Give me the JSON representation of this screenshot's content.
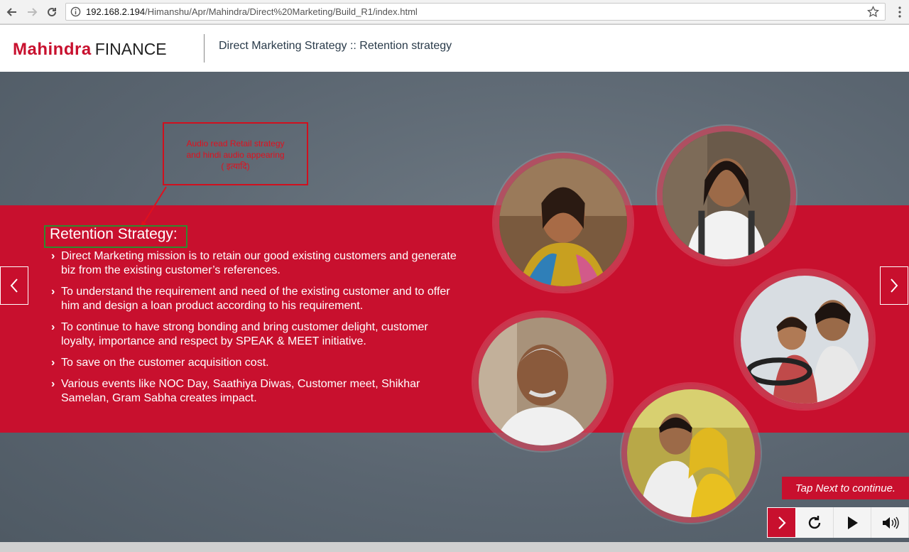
{
  "browser": {
    "url_host": "192.168.2.194",
    "url_path": "/Himanshu/Apr/Mahindra/Direct%20Marketing/Build_R1/index.html"
  },
  "header": {
    "brand": "Mahindra",
    "brand_sub": "FINANCE",
    "title": "Direct Marketing Strategy :: Retention strategy"
  },
  "callout": {
    "lines": [
      "Audio read Retail strategy",
      "and hindi audio appearing",
      "( इत्यादि)"
    ]
  },
  "content": {
    "heading": "Retention Strategy:",
    "bullets": [
      "Direct Marketing mission is to retain our good existing customers and generate biz from the existing customer’s references.",
      "To understand the requirement and need of the existing customer and to offer him and design a loan product according to his requirement.",
      "To continue to have strong bonding and bring customer delight, customer loyalty, importance and respect by SPEAK & MEET initiative.",
      "To save on the customer acquisition cost.",
      "Various events like NOC Day, Saathiya Diwas, Customer meet, Shikhar Samelan, Gram Sabha creates impact."
    ],
    "chevron": "›"
  },
  "player": {
    "tap_next": "Tap Next to continue."
  },
  "colors": {
    "brand_red": "#c8102e",
    "annotation_red": "#e0101e",
    "annotation_green": "#2f8a2f"
  },
  "icons": [
    "back-arrow-icon",
    "forward-arrow-icon",
    "reload-icon",
    "info-icon",
    "star-icon",
    "more-menu-icon",
    "chevron-left-icon",
    "chevron-right-icon",
    "replay-icon",
    "play-icon",
    "volume-icon"
  ]
}
